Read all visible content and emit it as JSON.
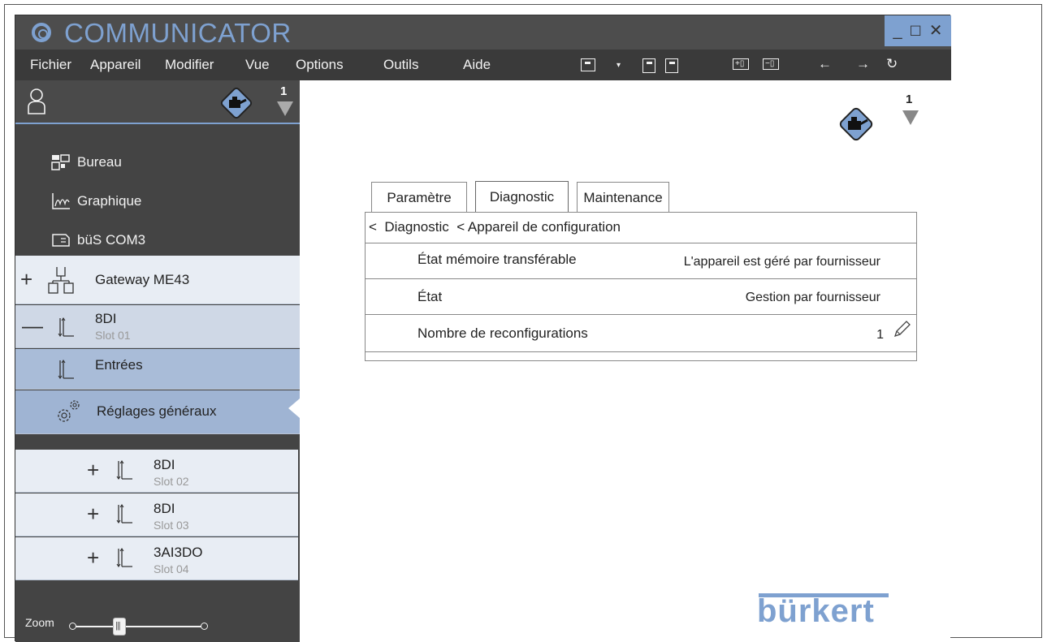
{
  "app": {
    "title": "COMMUNICATOR",
    "window_controls": [
      "_",
      "☐",
      "✕"
    ]
  },
  "menu": {
    "items": [
      "Fichier",
      "Appareil",
      "Modifier",
      "Vue",
      "Options",
      "Outils",
      "Aide"
    ],
    "toolbar_icons": [
      "device-card-icon",
      "save-icon",
      "save-as-icon",
      "add-device-icon",
      "remove-device-icon",
      "back-arrow-icon",
      "forward-arrow-icon",
      "refresh-icon"
    ]
  },
  "sidebar": {
    "device_count": "1",
    "nav": [
      {
        "label": "Bureau",
        "icon": "desktop-icon"
      },
      {
        "label": "Graphique",
        "icon": "graph-icon"
      },
      {
        "label": "büS COM3",
        "icon": "bus-port-icon"
      }
    ],
    "tree": {
      "gateway": {
        "symbol": "+",
        "label": "Gateway ME43"
      },
      "module_main": {
        "symbol": "—",
        "label": "8DI",
        "sub": "Slot 01"
      },
      "entrees": {
        "label": "Entrées"
      },
      "reglages": {
        "label": "Réglages généraux"
      },
      "children": [
        {
          "symbol": "+",
          "label": "8DI",
          "sub": "Slot 02"
        },
        {
          "symbol": "+",
          "label": "8DI",
          "sub": "Slot 03"
        },
        {
          "symbol": "+",
          "label": "3AI3DO",
          "sub": "Slot 04"
        }
      ]
    },
    "zoom": {
      "label": "Zoom"
    }
  },
  "main": {
    "device_count": "1",
    "tabs": [
      "Paramètre",
      "Diagnostic",
      "Maintenance"
    ],
    "active_tab": "Diagnostic",
    "breadcrumb": "<  Diagnostic  < Appareil de configuration",
    "rows": [
      {
        "label": "État mémoire transférable",
        "value": "L'appareil est géré par fournisseur"
      },
      {
        "label": "État",
        "value": "Gestion par fournisseur"
      },
      {
        "label": "Nombre de reconfigurations",
        "value": "1"
      }
    ],
    "brand": "bürkert"
  },
  "colors": {
    "accent": "#7ea1d0",
    "titlebar": "#4d4d4d",
    "menubar": "#3a3a3a",
    "sidebar": "#444444"
  }
}
